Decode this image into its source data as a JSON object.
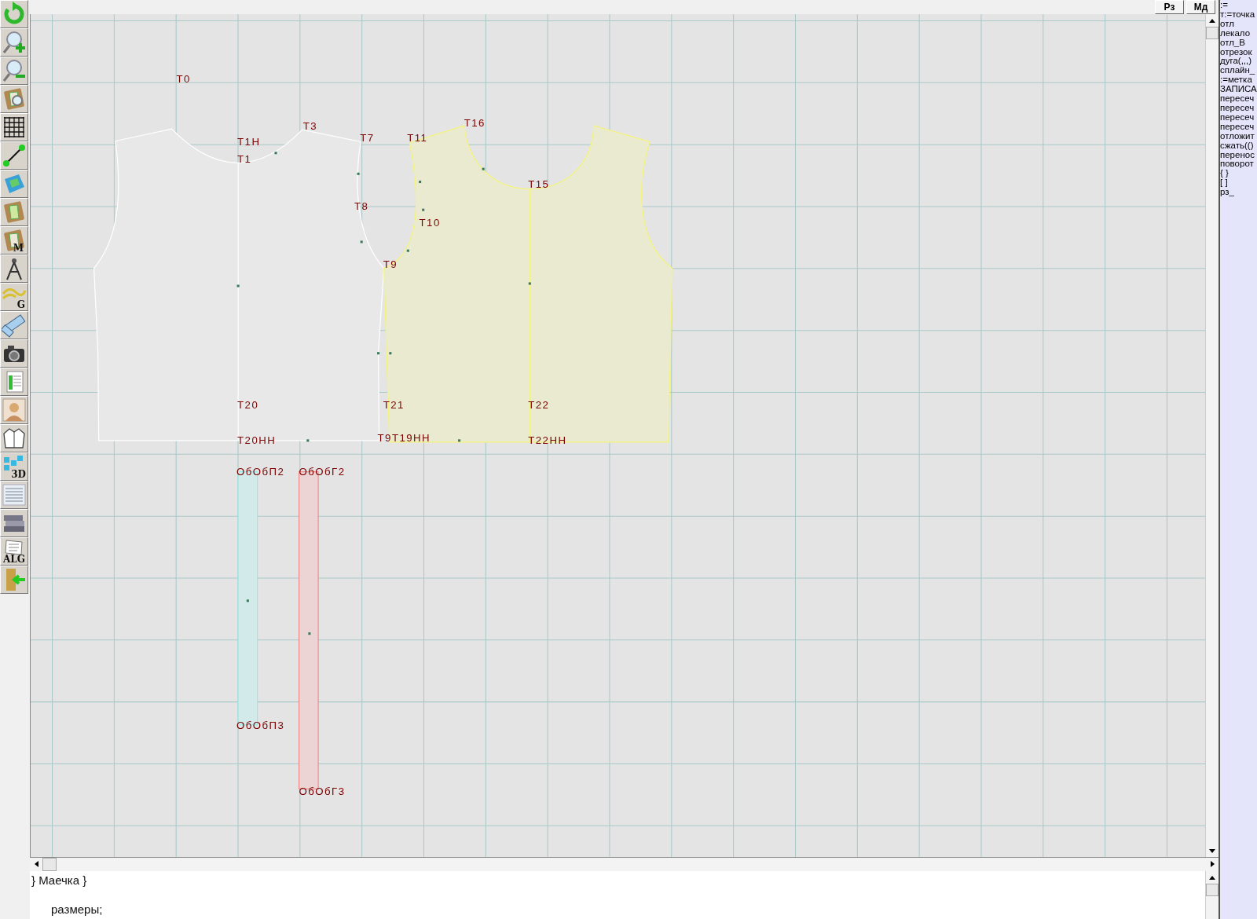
{
  "toolbar": [
    {
      "kind": "refresh"
    },
    {
      "kind": "zoom-in"
    },
    {
      "kind": "zoom-out"
    },
    {
      "kind": "pattern-search"
    },
    {
      "kind": "grid"
    },
    {
      "kind": "line"
    },
    {
      "kind": "map"
    },
    {
      "kind": "pattern"
    },
    {
      "kind": "pattern-letter",
      "letter": "M"
    },
    {
      "kind": "compass"
    },
    {
      "kind": "curves-letter",
      "letter": "G"
    },
    {
      "kind": "ruler"
    },
    {
      "kind": "camera"
    },
    {
      "kind": "spreadsheet"
    },
    {
      "kind": "person"
    },
    {
      "kind": "jacket"
    },
    {
      "kind": "blocks-letter",
      "letter": "3D"
    },
    {
      "kind": "list"
    },
    {
      "kind": "books"
    },
    {
      "kind": "document-letter",
      "letter": "ALG"
    },
    {
      "kind": "exit"
    }
  ],
  "top_buttons": [
    "Рз",
    "Мд"
  ],
  "point_labels": [
    "Т0",
    "Т3",
    "Т1Н",
    "Т1",
    "Т7",
    "Т11",
    "Т16",
    "Т15",
    "Т8",
    "Т10",
    "Т9",
    "Т20",
    "Т21",
    "Т22",
    "Т20НН",
    "Т9Т19НН",
    "Т22НН",
    "ОбОбП2",
    "ОбОбГ2",
    "ОбОбП3",
    "ОбОбГ3"
  ],
  "commands": [
    ":=",
    "т:=точка",
    "отл",
    "лекало",
    "отл_В",
    "отрезок",
    "дуга(,,,)",
    "сплайн_",
    ":=метка",
    "ЗАПИСА",
    "пересеч",
    "пересеч",
    "пересеч",
    "пересеч",
    "отложит",
    "сжать(()",
    "перенос",
    "поворот",
    "{ }",
    "[ ]",
    "рз_"
  ],
  "editor_lines": [
    {
      "text": "} Маечка }",
      "indent": false
    },
    {
      "text": "размеры;",
      "indent": true
    }
  ]
}
